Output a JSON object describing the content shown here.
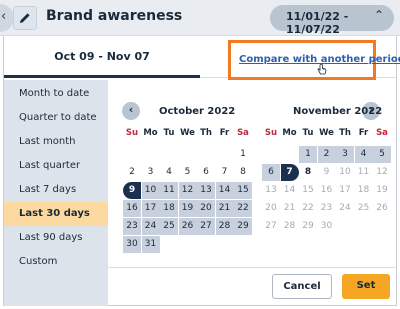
{
  "header": {
    "back_icon": "chevron-left-icon",
    "edit_icon": "pencil-icon",
    "title": "Brand awareness",
    "date_range": "11/01/22 - 11/07/22",
    "toggle_icon": "chevron-up-icon"
  },
  "tabs": {
    "current": "Oct 09 - Nov 07",
    "compare": "Compare with another period"
  },
  "presets": [
    {
      "label": "Month to date",
      "selected": false
    },
    {
      "label": "Quarter to date",
      "selected": false
    },
    {
      "label": "Last month",
      "selected": false
    },
    {
      "label": "Last quarter",
      "selected": false
    },
    {
      "label": "Last 7 days",
      "selected": false
    },
    {
      "label": "Last 30 days",
      "selected": true
    },
    {
      "label": "Last 90 days",
      "selected": false
    },
    {
      "label": "Custom",
      "selected": false
    }
  ],
  "calendar": {
    "weekdays": [
      "Su",
      "Mo",
      "Tu",
      "We",
      "Th",
      "Fr",
      "Sa"
    ],
    "months": [
      {
        "title": "October 2022",
        "weeks": [
          [
            "",
            "",
            "",
            "",
            "",
            "",
            "1"
          ],
          [
            "2",
            "3",
            "4",
            "5",
            "6",
            "7",
            "8"
          ],
          [
            "9",
            "10",
            "11",
            "12",
            "13",
            "14",
            "15"
          ],
          [
            "16",
            "17",
            "18",
            "19",
            "20",
            "21",
            "22"
          ],
          [
            "23",
            "24",
            "25",
            "26",
            "27",
            "28",
            "29"
          ],
          [
            "30",
            "31",
            "",
            "",
            "",
            "",
            ""
          ]
        ],
        "range_start": "9",
        "range_end": "31",
        "range_end_cap": ""
      },
      {
        "title": "November 2022",
        "weeks": [
          [
            "",
            "",
            "1",
            "2",
            "3",
            "4",
            "5"
          ],
          [
            "6",
            "7",
            "8",
            "9",
            "10",
            "11",
            "12"
          ],
          [
            "13",
            "14",
            "15",
            "16",
            "17",
            "18",
            "19"
          ],
          [
            "20",
            "21",
            "22",
            "23",
            "24",
            "25",
            "26"
          ],
          [
            "27",
            "28",
            "29",
            "30",
            "",
            "",
            ""
          ]
        ],
        "range_start": "1",
        "range_end": "7",
        "today": "8"
      }
    ]
  },
  "footer": {
    "cancel": "Cancel",
    "set": "Set"
  },
  "colors": {
    "accent": "#f5a623",
    "highlight": "#f07a21",
    "selected_day": "#1b2f4e",
    "range_fill": "#c7d0dc",
    "weekend": "#c0273a"
  }
}
